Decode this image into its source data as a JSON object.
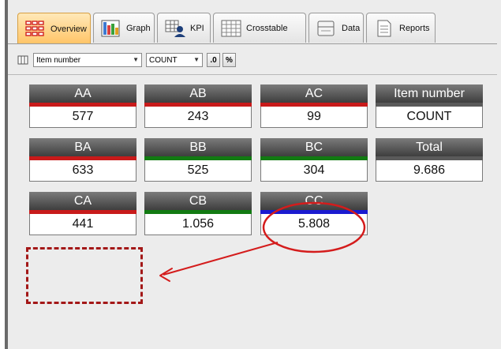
{
  "tabs": [
    {
      "label": "Overview",
      "icon": "overview-grid-icon",
      "active": true
    },
    {
      "label": "Graph",
      "icon": "graph-icon",
      "active": false
    },
    {
      "label": "KPI",
      "icon": "kpi-icon",
      "active": false
    },
    {
      "label": "Crosstable",
      "icon": "crosstable-icon",
      "active": false
    },
    {
      "label": "Data",
      "icon": "data-icon",
      "active": false
    },
    {
      "label": "Reports",
      "icon": "reports-icon",
      "active": false
    }
  ],
  "toolbar": {
    "field_select": "Item number",
    "agg_select": "COUNT",
    "decimal_button": ".0",
    "percent_button": "%"
  },
  "tiles": [
    {
      "title": "AA",
      "value": "577",
      "bar_color": "#c81a1a"
    },
    {
      "title": "AB",
      "value": "243",
      "bar_color": "#c81a1a"
    },
    {
      "title": "AC",
      "value": "99",
      "bar_color": "#c81a1a"
    },
    {
      "title": "Item number",
      "value": "COUNT",
      "bar_color": "#5a5a5a"
    },
    {
      "title": "BA",
      "value": "633",
      "bar_color": "#c81a1a"
    },
    {
      "title": "BB",
      "value": "525",
      "bar_color": "#127a12"
    },
    {
      "title": "BC",
      "value": "304",
      "bar_color": "#127a12"
    },
    {
      "title": "Total",
      "value": "9.686",
      "bar_color": "#5a5a5a"
    },
    {
      "title": "CA",
      "value": "441",
      "bar_color": "#c81a1a"
    },
    {
      "title": "CB",
      "value": "1.056",
      "bar_color": "#127a12"
    },
    {
      "title": "CC",
      "value": "5.808",
      "bar_color": "#1a1ad0"
    }
  ],
  "annotation_color": "#d41c1c"
}
